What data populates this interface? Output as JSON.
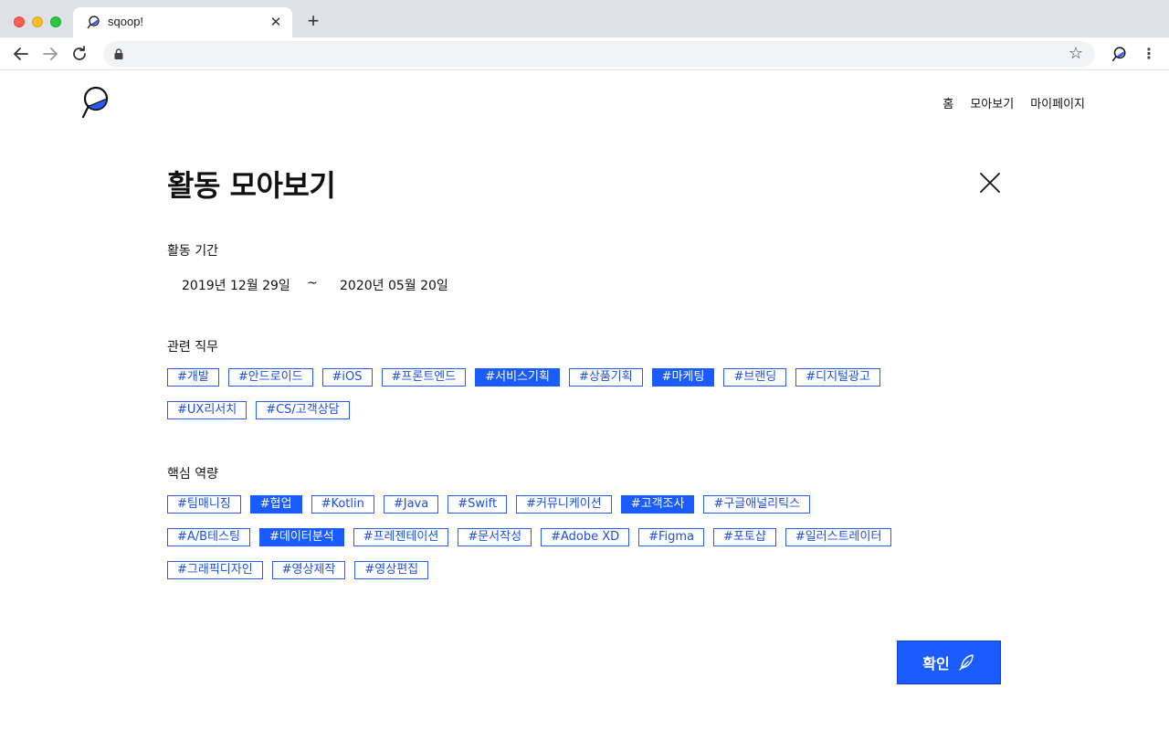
{
  "browser": {
    "tab_title": "sqoop!",
    "tab_close": "✕",
    "new_tab": "+",
    "star": "☆",
    "menu": "⋮"
  },
  "site": {
    "nav": [
      "홈",
      "모아보기",
      "마이페이지"
    ]
  },
  "modal": {
    "title": "활동 모아보기",
    "period_label": "활동 기간",
    "period_start": "2019년 12월 29일",
    "period_sep": "~",
    "period_end": "2020년 05월 20일",
    "jobs_label": "관련 직무",
    "jobs": [
      {
        "label": "#개발",
        "selected": false
      },
      {
        "label": "#안드로이드",
        "selected": false
      },
      {
        "label": "#iOS",
        "selected": false
      },
      {
        "label": "#프론트엔드",
        "selected": false
      },
      {
        "label": "#서비스기획",
        "selected": true
      },
      {
        "label": "#상품기획",
        "selected": false
      },
      {
        "label": "#마케팅",
        "selected": true
      },
      {
        "label": "#브랜딩",
        "selected": false
      },
      {
        "label": "#디지털광고",
        "selected": false
      },
      {
        "label": "#UX리서치",
        "selected": false
      },
      {
        "label": "#CS/고객상담",
        "selected": false
      }
    ],
    "skills_label": "핵심 역량",
    "skills": [
      {
        "label": "#팀매니징",
        "selected": false
      },
      {
        "label": "#협업",
        "selected": true
      },
      {
        "label": "#Kotlin",
        "selected": false
      },
      {
        "label": "#Java",
        "selected": false
      },
      {
        "label": "#Swift",
        "selected": false
      },
      {
        "label": "#커뮤니케이션",
        "selected": false
      },
      {
        "label": "#고객조사",
        "selected": true
      },
      {
        "label": "#구글애널리틱스",
        "selected": false
      },
      {
        "label": "#A/B테스팅",
        "selected": false
      },
      {
        "label": "#데이터분석",
        "selected": true
      },
      {
        "label": "#프레젠테이션",
        "selected": false
      },
      {
        "label": "#문서작성",
        "selected": false
      },
      {
        "label": "#Adobe XD",
        "selected": false
      },
      {
        "label": "#Figma",
        "selected": false
      },
      {
        "label": "#포토샵",
        "selected": false
      },
      {
        "label": "#일러스트레이터",
        "selected": false
      },
      {
        "label": "#그래픽디자인",
        "selected": false
      },
      {
        "label": "#영상제작",
        "selected": false
      },
      {
        "label": "#영상편집",
        "selected": false
      }
    ],
    "confirm_label": "확인"
  },
  "colors": {
    "accent": "#1a5cff",
    "chip_border": "#2a5cf5"
  },
  "icons": {
    "close": "close-icon",
    "confirm": "feather-icon",
    "logo": "sqoop-logo-icon"
  }
}
